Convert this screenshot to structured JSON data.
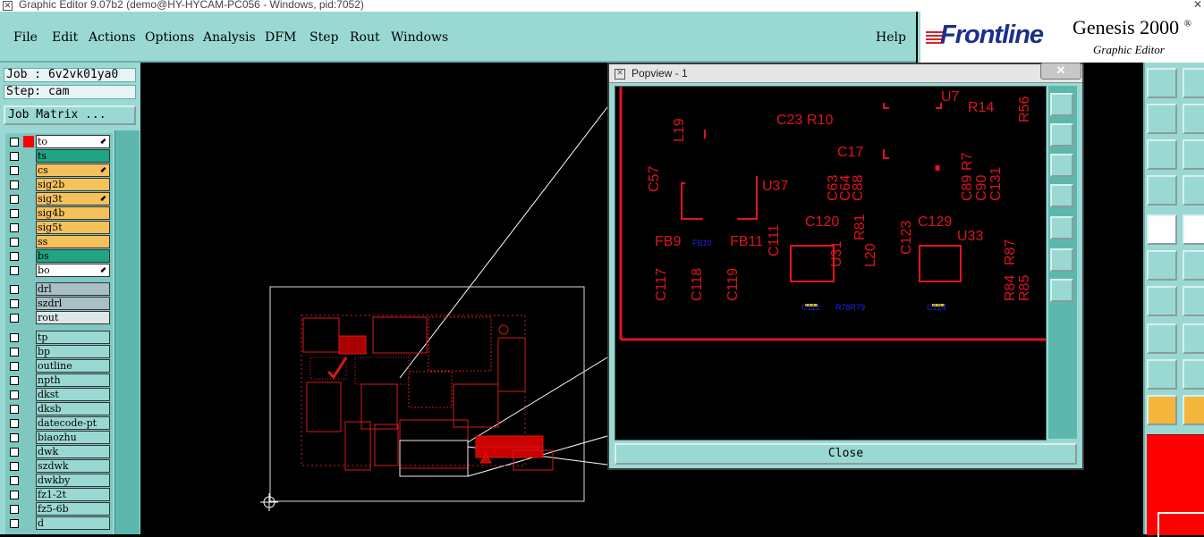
{
  "window": {
    "title": "Graphic Editor 9.07b2 (demo@HY-HYCAM-PC056 - Windows, pid:7052)"
  },
  "menu": {
    "items": [
      {
        "label": "File"
      },
      {
        "label": "Edit"
      },
      {
        "label": "Actions"
      },
      {
        "label": "Options"
      },
      {
        "label": "Analysis"
      },
      {
        "label": "DFM"
      },
      {
        "label": "Step"
      },
      {
        "label": "Rout"
      },
      {
        "label": "Windows"
      }
    ],
    "help": "Help"
  },
  "logo": {
    "brand": "Frontline",
    "product": "Genesis 2000",
    "product_mark": "®",
    "subtitle": "Graphic Editor"
  },
  "job": {
    "label": "Job : 6v2vk01ya0",
    "step": "Step: cam",
    "matrix_button": "Job Matrix ..."
  },
  "layers": {
    "group1": [
      {
        "name": "to",
        "color": "#ffffff",
        "arrow": true,
        "active": true
      },
      {
        "name": "ts",
        "color": "#21a482",
        "arrow": false
      },
      {
        "name": "cs",
        "color": "#f5c15b",
        "arrow": true
      },
      {
        "name": "sig2b",
        "color": "#f5c15b",
        "arrow": false
      },
      {
        "name": "sig3t",
        "color": "#f5c15b",
        "arrow": true
      },
      {
        "name": "sig4b",
        "color": "#f5c15b",
        "arrow": false
      },
      {
        "name": "sig5t",
        "color": "#f5c15b",
        "arrow": false
      },
      {
        "name": "ss",
        "color": "#f5c15b",
        "arrow": false
      },
      {
        "name": "bs",
        "color": "#21a482",
        "arrow": false
      },
      {
        "name": "bo",
        "color": "#ffffff",
        "arrow": true
      }
    ],
    "group2": [
      {
        "name": "drl",
        "color": "#a9bfc6"
      },
      {
        "name": "szdrl",
        "color": "#a9bfc6"
      },
      {
        "name": "rout",
        "color": "#dde6e8"
      }
    ],
    "group3": [
      {
        "name": "tp",
        "color": "#9ad9d3"
      },
      {
        "name": "bp",
        "color": "#9ad9d3"
      },
      {
        "name": "outline",
        "color": "#9ad9d3"
      },
      {
        "name": "npth",
        "color": "#9ad9d3"
      },
      {
        "name": "dkst",
        "color": "#9ad9d3"
      },
      {
        "name": "dksb",
        "color": "#9ad9d3"
      },
      {
        "name": "datecode-pt",
        "color": "#9ad9d3"
      },
      {
        "name": "biaozhu",
        "color": "#9ad9d3"
      },
      {
        "name": "dwk",
        "color": "#9ad9d3"
      },
      {
        "name": "szdwk",
        "color": "#9ad9d3"
      },
      {
        "name": "dwkby",
        "color": "#9ad9d3"
      },
      {
        "name": "fz1-2t",
        "color": "#9ad9d3"
      },
      {
        "name": "fz5-6b",
        "color": "#9ad9d3"
      },
      {
        "name": "d",
        "color": "#9ad9d3"
      }
    ]
  },
  "popview": {
    "title": "Popview - 1",
    "close_label": "Close",
    "close_x": "✕",
    "refdes_red": [
      "C23",
      "R10",
      "U7",
      "R14",
      "R56",
      "L19",
      "C17",
      "C57",
      "U37",
      "C63",
      "C64",
      "C88",
      "C89",
      "R7",
      "C90",
      "C131",
      "C120",
      "C129",
      "R81",
      "C123",
      "U33",
      "FB9",
      "FB11",
      "C111",
      "U31",
      "L20",
      "R87",
      "R84",
      "C117",
      "C118",
      "C119",
      "R85"
    ],
    "refdes_blue": [
      "FB10",
      "C112",
      "R78R79",
      "C124"
    ]
  },
  "colors": {
    "accent": "#9ad9d3",
    "trace": "#e0141e",
    "blue_text": "#2222ee"
  }
}
